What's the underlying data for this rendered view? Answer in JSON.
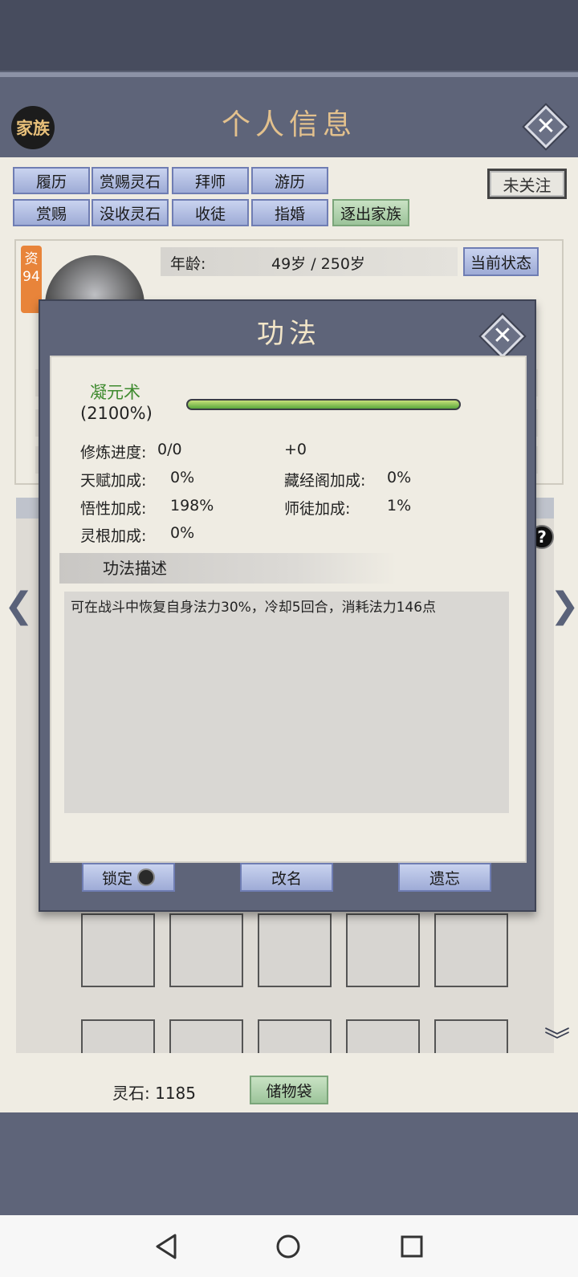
{
  "header": {
    "family_badge": "家族",
    "title": "个人信息",
    "close_icon": "close-icon"
  },
  "tabs": {
    "row1": [
      "履历",
      "赏赐灵石",
      "拜师",
      "游历"
    ],
    "row2": [
      "赏赐",
      "没收灵石",
      "收徒",
      "指婚"
    ],
    "expel": "逐出家族",
    "follow": "未关注"
  },
  "character": {
    "quality_label": "资",
    "quality_value": "94",
    "age_label": "年龄:",
    "age_value": "49岁 / 250岁",
    "status_button": "当前状态"
  },
  "modal": {
    "title": "功法",
    "skill_name": "凝元术",
    "skill_percent": "(2100%)",
    "progress_fraction": 1.0,
    "progress_color": "#5aa83c",
    "stats": {
      "cultivation_label": "修炼进度:",
      "cultivation_value": "0/0",
      "cultivation_bonus": "+0",
      "talent_label": "天赋加成:",
      "talent_value": "0%",
      "library_label": "藏经阁加成:",
      "library_value": "0%",
      "insight_label": "悟性加成:",
      "insight_value": "198%",
      "mentor_label": "师徒加成:",
      "mentor_value": "1%",
      "root_label": "灵根加成:",
      "root_value": "0%"
    },
    "desc_header": "功法描述",
    "description": "可在战斗中恢复自身法力30%，冷却5回合，消耗法力146点",
    "buttons": {
      "lock": "锁定",
      "rename": "改名",
      "forget": "遗忘"
    }
  },
  "bottom": {
    "spirit_stones": "灵石: 1185",
    "storage_button": "储物袋"
  }
}
